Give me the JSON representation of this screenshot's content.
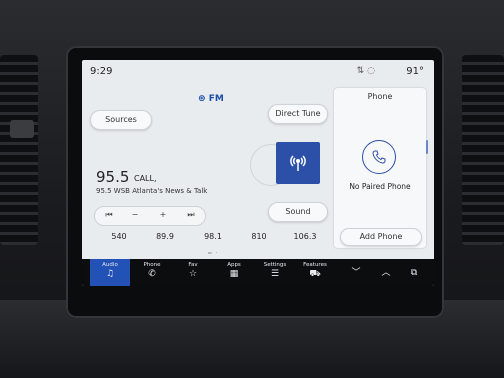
{
  "status": {
    "time": "9:29",
    "temperature": "91°"
  },
  "source": {
    "label": "FM"
  },
  "buttons": {
    "sources": "Sources",
    "direct_tune": "Direct Tune",
    "sound": "Sound"
  },
  "now_playing": {
    "frequency": "95.5",
    "callsign": "CALL,",
    "station_name": "95.5 WSB Atlanta's News & Talk"
  },
  "controls": {
    "seek_back": "⏮",
    "minus": "−",
    "plus": "+",
    "seek_forward": "⏭"
  },
  "presets": [
    "540",
    "89.9",
    "98.1",
    "810",
    "106.3"
  ],
  "phone_panel": {
    "title": "Phone",
    "status": "No Paired Phone",
    "add_label": "Add Phone"
  },
  "nav": [
    {
      "label": "Audio",
      "icon": "music-note-icon"
    },
    {
      "label": "Phone",
      "icon": "phone-icon"
    },
    {
      "label": "Fav",
      "icon": "star-icon"
    },
    {
      "label": "Apps",
      "icon": "grid-icon"
    },
    {
      "label": "Settings",
      "icon": "sliders-icon"
    },
    {
      "label": "Features",
      "icon": "car-icon"
    }
  ],
  "colors": {
    "accent": "#2352b7",
    "screen_bg": "#e9ecef",
    "navbar_bg": "#0c0d0f"
  }
}
